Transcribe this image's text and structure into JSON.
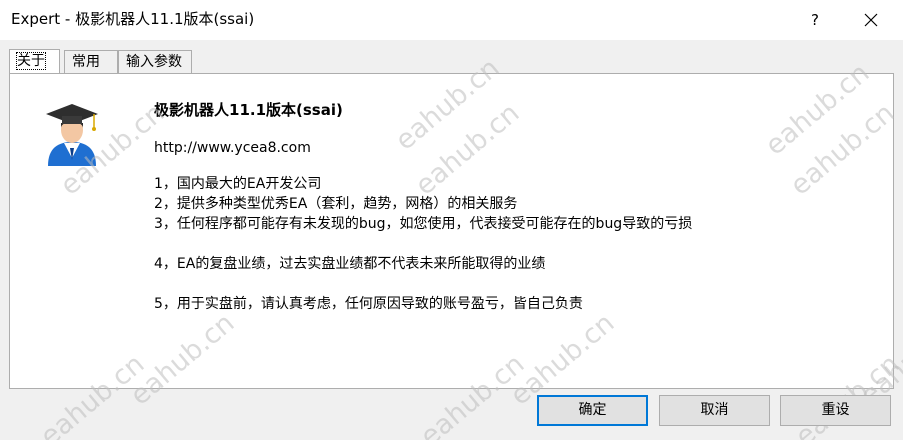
{
  "window": {
    "title": "Expert - 极影机器人11.1版本(ssai)",
    "help_label": "?"
  },
  "tabs": [
    {
      "label": "关于",
      "active": true
    },
    {
      "label": "常用",
      "active": false
    },
    {
      "label": "输入参数",
      "active": false
    }
  ],
  "about": {
    "heading": "极影机器人11.1版本(ssai)",
    "url": "http://www.ycea8.com",
    "lines": [
      "1，国内最大的EA开发公司",
      "2，提供多种类型优秀EA（套利，趋势，网格）的相关服务",
      "3，任何程序都可能存有未发现的bug，如您使用，代表接受可能存在的bug导致的亏损",
      "4，EA的复盘业绩，过去实盘业绩都不代表未来所能取得的业绩",
      "5，用于实盘前，请认真考虑，任何原因导致的账号盈亏，皆自己负责"
    ]
  },
  "watermark": "eahub.cn",
  "buttons": {
    "ok": "确定",
    "cancel": "取消",
    "reset": "重设"
  },
  "colors": {
    "accent": "#0078d7",
    "background": "#f0f0f0",
    "panel": "#ffffff"
  }
}
